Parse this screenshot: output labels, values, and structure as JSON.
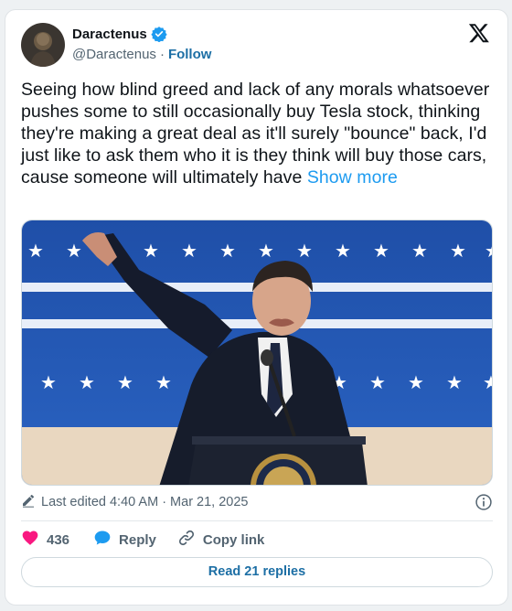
{
  "author": {
    "name": "Daractenus",
    "handle": "@Daractenus",
    "separator": "·",
    "follow_label": "Follow"
  },
  "tweet": {
    "text": "Seeing how blind greed and lack of any morals whatsoever pushes some to still occasionally buy Tesla stock, thinking they're making a great deal as it'll surely \"bounce\" back, I'd just like to ask them who it is they think will buy those cars, cause someone will ultimately have ",
    "show_more_label": "Show more"
  },
  "meta": {
    "edited_label": "Last edited 4:40 AM · Mar 21, 2025"
  },
  "actions": {
    "like_count": "436",
    "reply_label": "Reply",
    "copy_link_label": "Copy link"
  },
  "read_replies_label": "Read 21 replies",
  "icons": {
    "verified": "verified-badge-icon",
    "x_logo": "x-logo-icon",
    "edit": "pencil-icon",
    "info": "info-icon",
    "like": "heart-icon",
    "reply": "speech-bubble-icon",
    "copy_link": "link-icon"
  },
  "colors": {
    "link": "#1d9bf0",
    "follow": "#1d6fa5",
    "heart": "#f91880",
    "reply_icon": "#1d9bf0",
    "muted": "#536471"
  }
}
